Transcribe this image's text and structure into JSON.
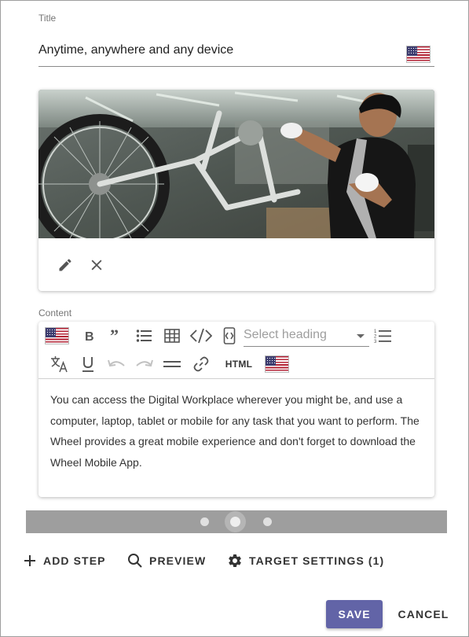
{
  "title_field": {
    "label": "Title",
    "value": "Anytime, anywhere and any device",
    "language_flag": "us-flag-icon"
  },
  "image_card": {
    "image_subject": "worker-assembling-bicycle-photo",
    "actions": [
      "edit-icon",
      "close-icon"
    ]
  },
  "content_field": {
    "label": "Content",
    "toolbar": {
      "row1": [
        "us-flag-icon",
        "bold-icon",
        "quote-icon",
        "bulleted-list-icon",
        "table-icon",
        "code-icon",
        "code-block-icon",
        "heading-select",
        "numbered-list-icon"
      ],
      "row2": [
        "translate-icon",
        "underline-icon",
        "undo-icon",
        "redo-icon",
        "horizontal-line-icon",
        "link-icon",
        "html-button",
        "us-flag-icon"
      ],
      "heading_placeholder": "Select heading",
      "html_label": "HTML"
    },
    "body_text": "You can access the Digital Workplace wherever you might be, and use a computer, laptop, tablet or mobile for any task that you want to perform. The Wheel provides a great mobile experience and don't forget to download the Wheel Mobile App."
  },
  "carousel": {
    "dot_count": 3,
    "active_index": 1
  },
  "actions": {
    "add_step": "ADD STEP",
    "preview": "PREVIEW",
    "target_settings": "TARGET SETTINGS (1)"
  },
  "footer": {
    "save": "SAVE",
    "cancel": "CANCEL"
  },
  "colors": {
    "primary": "#6264a7",
    "carousel_bar": "#9e9e9e",
    "flag_red": "#b22234",
    "flag_blue": "#3c3b6e"
  }
}
